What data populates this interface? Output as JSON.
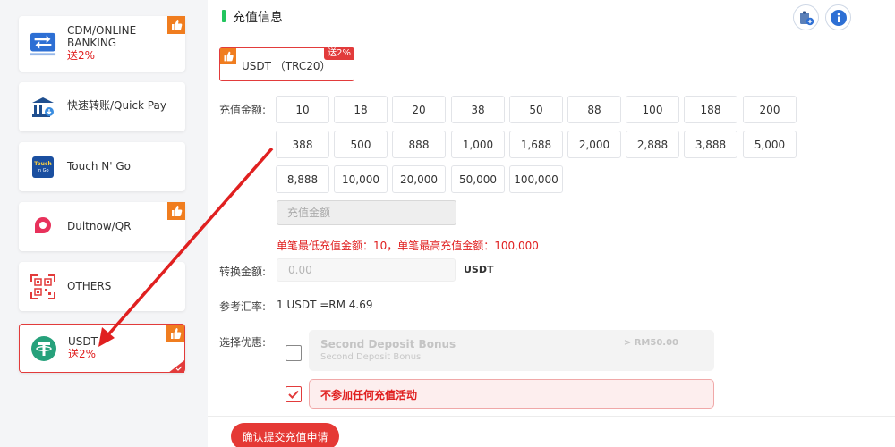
{
  "sidebar": {
    "items": [
      {
        "label": "CDM/ONLINE BANKING",
        "bonus": "送2%",
        "icon": "bank-transfer-icon",
        "hot": true
      },
      {
        "label": "快速转账/Quick Pay",
        "bonus": "",
        "icon": "bank-building-icon",
        "hot": false
      },
      {
        "label": "Touch N' Go",
        "bonus": "",
        "icon": "touch-n-go-icon",
        "hot": false
      },
      {
        "label": "Duitnow/QR",
        "bonus": "",
        "icon": "duitnow-icon",
        "hot": true
      },
      {
        "label": "OTHERS",
        "bonus": "",
        "icon": "qr-code-icon",
        "hot": false
      },
      {
        "label": "USDT",
        "bonus": "送2%",
        "icon": "tether-icon",
        "hot": true,
        "active": true
      }
    ]
  },
  "header": {
    "title": "充值信息",
    "icons": [
      "clipboard-add-icon",
      "info-icon"
    ]
  },
  "currency_tab": {
    "label": "USDT （TRC20）",
    "badge": "送2%"
  },
  "amount": {
    "label": "充值金额:",
    "presets": [
      "10",
      "18",
      "20",
      "38",
      "50",
      "88",
      "100",
      "188",
      "200",
      "388",
      "500",
      "888",
      "1,000",
      "1,688",
      "2,000",
      "2,888",
      "3,888",
      "5,000",
      "8,888",
      "10,000",
      "20,000",
      "50,000",
      "100,000"
    ],
    "placeholder": "充值金额",
    "limit_note": "单笔最低充值金额：10，单笔最高充值金额：100,000"
  },
  "conversion": {
    "label": "转换金额:",
    "value": "0.00",
    "unit": "USDT"
  },
  "rate": {
    "label": "参考汇率:",
    "value": "1 USDT =RM 4.69"
  },
  "promotion": {
    "label": "选择优惠:",
    "options": [
      {
        "title": "Second Deposit Bonus",
        "subtitle": "Second Deposit Bonus",
        "amount": "> RM50.00",
        "checked": false
      },
      {
        "title": "不参加任何充值活动",
        "checked": true
      }
    ]
  },
  "submit_label": "确认提交充值申请",
  "colors": {
    "accent": "#e23b3b",
    "section_bar": "#22c55e",
    "tether": "#26a17b"
  }
}
